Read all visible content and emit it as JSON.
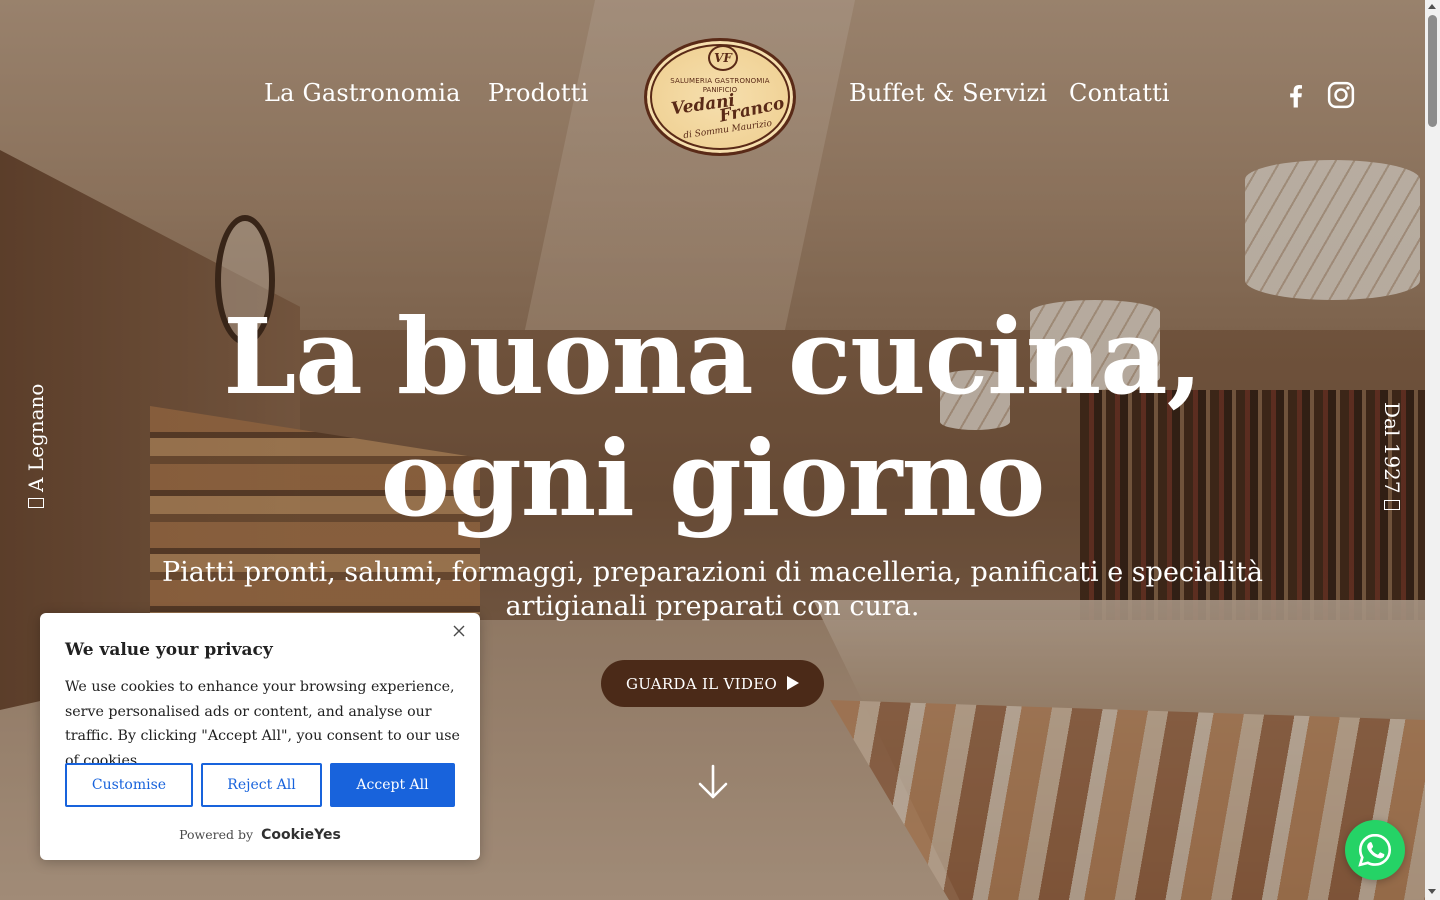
{
  "nav": {
    "left": [
      {
        "label": "La Gastronomia"
      },
      {
        "label": "Prodotti"
      }
    ],
    "right": [
      {
        "label": "Buffet & Servizi"
      },
      {
        "label": "Contatti"
      }
    ],
    "social": [
      {
        "icon": "facebook-icon"
      },
      {
        "icon": "instagram-icon"
      }
    ]
  },
  "logo": {
    "monogram": "VF",
    "line1": "SALUMERIA GASTRONOMIA",
    "line2": "PANIFICIO",
    "script1": "Vedani",
    "script2": "Franco",
    "subtitle": "di Sommu Maurizio"
  },
  "side": {
    "left": "A Legnano",
    "right": "Dal 1927"
  },
  "hero": {
    "title": "La buona cucina, ogni giorno",
    "subtitle": "Piatti pronti, salumi, formaggi, preparazioni di macelleria, panificati e specialità artigianali preparati con cura.",
    "video_button": "GUARDA IL VIDEO",
    "scroll_icon": "arrow-down-icon"
  },
  "cookie": {
    "title": "We value your privacy",
    "text": "We use cookies to enhance your browsing experience, serve personalised ads or content, and analyse our traffic. By clicking \"Accept All\", you consent to our use of cookies.",
    "customise": "Customise",
    "reject": "Reject All",
    "accept": "Accept All",
    "powered_by": "Powered by",
    "brand": "CookieYes"
  },
  "colors": {
    "accent_brown": "#4b2a18",
    "cookie_blue": "#1863dc",
    "whatsapp_green": "#25d366",
    "logo_cream": "#f0d296"
  }
}
